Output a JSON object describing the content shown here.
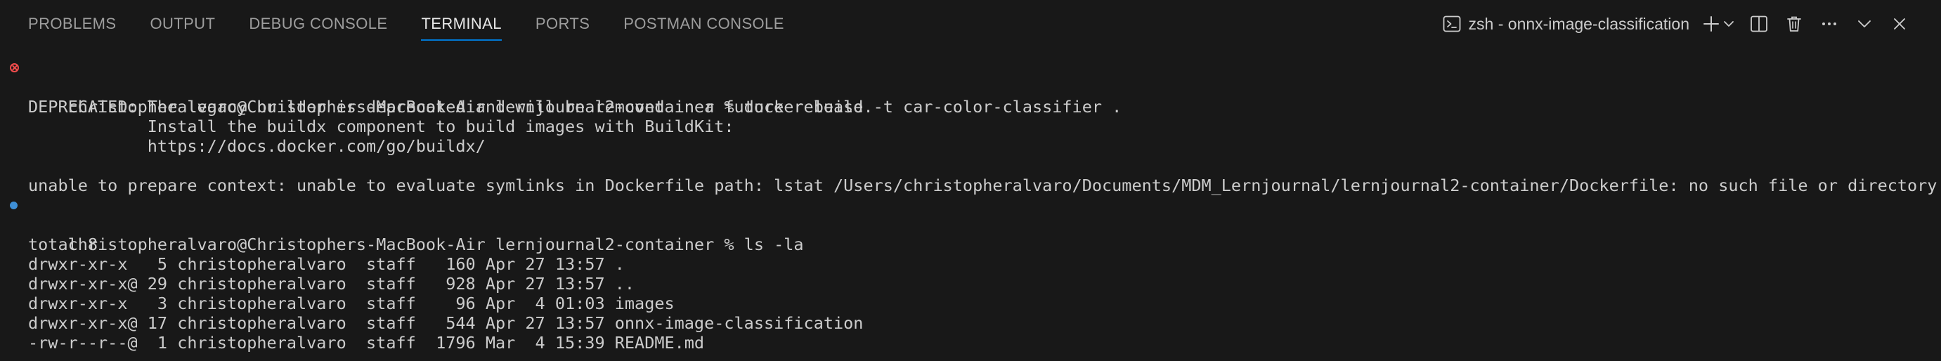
{
  "panel": {
    "tabs": [
      {
        "label": "PROBLEMS",
        "active": false
      },
      {
        "label": "OUTPUT",
        "active": false
      },
      {
        "label": "DEBUG CONSOLE",
        "active": false
      },
      {
        "label": "TERMINAL",
        "active": true
      },
      {
        "label": "PORTS",
        "active": false
      },
      {
        "label": "POSTMAN CONSOLE",
        "active": false
      }
    ],
    "terminal_name": "zsh - onnx-image-classification",
    "icons": {
      "terminal": "terminal-icon",
      "new": "plus-icon",
      "dropdown": "chevron-down-icon",
      "split": "split-terminal-icon",
      "kill": "trash-icon",
      "more": "ellipsis-icon",
      "collapse": "chevron-down-icon"
    },
    "accent_color": "#0078d4"
  },
  "terminal": {
    "colors": {
      "background": "#181818",
      "foreground": "#cccccc",
      "error": "#f14c4c",
      "success": "#3e8fd6"
    },
    "lines": [
      "christopheralvaro@Christophers-MacBook-Air lernjournal2-container % docker build -t car-color-classifier .",
      "",
      "DEPRECATED: The legacy builder is deprecated and will be removed in a future release.",
      "            Install the buildx component to build images with BuildKit:",
      "            https://docs.docker.com/go/buildx/",
      "",
      "unable to prepare context: unable to evaluate symlinks in Dockerfile path: lstat /Users/christopheralvaro/Documents/MDM_Lernjournal/lernjournal2-container/Dockerfile: no such file or directory",
      "christopheralvaro@Christophers-MacBook-Air lernjournal2-container % ls -la",
      "",
      "total 8",
      "drwxr-xr-x   5 christopheralvaro  staff   160 Apr 27 13:57 .",
      "drwxr-xr-x@ 29 christopheralvaro  staff   928 Apr 27 13:57 ..",
      "drwxr-xr-x   3 christopheralvaro  staff    96 Apr  4 01:03 images",
      "drwxr-xr-x@ 17 christopheralvaro  staff   544 Apr 27 13:57 onnx-image-classification",
      "-rw-r--r--@  1 christopheralvaro  staff  1796 Mar  4 15:39 README.md"
    ]
  }
}
